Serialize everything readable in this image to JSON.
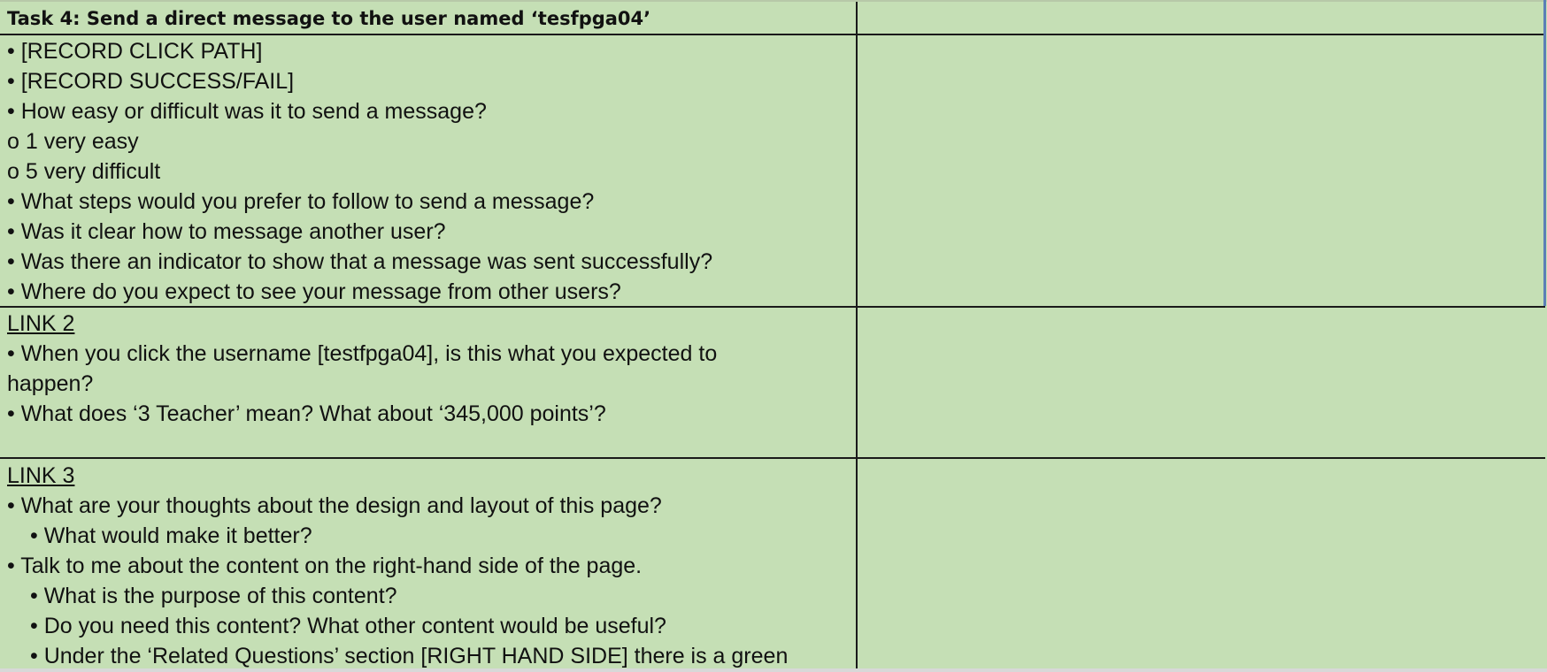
{
  "header": {
    "title": "Task 4: Send a direct message to the user named ‘tesfpga04’"
  },
  "section1": {
    "lines": [
      "• [RECORD CLICK PATH]",
      "• [RECORD SUCCESS/FAIL]",
      "• How easy or difficult was it to send a message?",
      "o 1 very easy",
      "o 5 very difficult",
      "• What steps would you prefer to follow to send a message?",
      "• Was it clear how to message another user?",
      "• Was there an indicator to show that a message was sent successfully?",
      "• Where do you expect to see your message from other users?"
    ]
  },
  "section2": {
    "title": "LINK 2",
    "lines": [
      "• When you click the username [testfpga04], is this what you expected to",
      "happen?",
      "• What does ‘3 Teacher’ mean? What about ‘345,000 points’?"
    ]
  },
  "section3": {
    "title": "LINK 3",
    "lines": [
      "• What are your thoughts about the design and layout of this page?",
      "•  What would make it better?",
      "• Talk to me about the content on the right-hand side of the page.",
      "•  What is the purpose of this content?",
      "•  Do you need this content?  What other content would be useful?",
      "•  Under the ‘Related Questions’ section [RIGHT HAND SIDE] there is a green"
    ]
  }
}
